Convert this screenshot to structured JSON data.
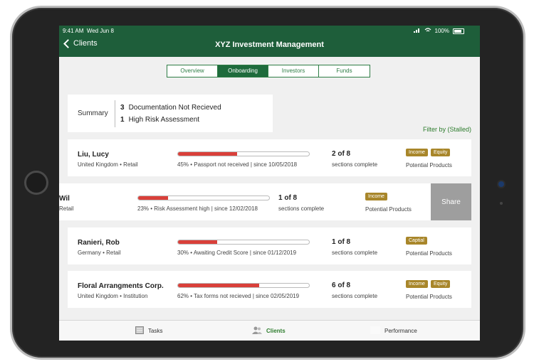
{
  "status": {
    "time": "9:41 AM",
    "date": "Wed Jun 8",
    "battery": "100%"
  },
  "header": {
    "back_label": "Clients",
    "title": "XYZ Investment Management"
  },
  "tabs": [
    {
      "label": "Overview",
      "active": false
    },
    {
      "label": "Onboarding",
      "active": true
    },
    {
      "label": "Investors",
      "active": false
    },
    {
      "label": "Funds",
      "active": false
    }
  ],
  "summary": {
    "label": "Summary",
    "items": [
      {
        "count": "3",
        "text": "Documentation Not Recieved"
      },
      {
        "count": "1",
        "text": "High Risk Assessment"
      }
    ]
  },
  "filter_label": "Filter by (Stalled)",
  "clients": [
    {
      "name": "Liu, Lucy",
      "sub": "United Kingdom • Retail",
      "progress": 0.45,
      "note": "45% • Passport not received | since 10/05/2018",
      "count": "2 of 8",
      "sections": "sections complete",
      "tags": [
        "Income",
        "Equity"
      ],
      "products": "Potential Products"
    },
    {
      "name": "Wil",
      "sub": "Retail",
      "progress": 0.23,
      "note": "23% • Risk Assessment high | since 12/02/2018",
      "count": "1 of 8",
      "sections": "sections complete",
      "tags": [
        "Income"
      ],
      "products": "Potential Products"
    },
    {
      "name": "Ranieri, Rob",
      "sub": "Germany • Retail",
      "progress": 0.3,
      "note": "30% • Awaiting Credit Score | since 01/12/2019",
      "count": "1 of 8",
      "sections": "sections complete",
      "tags": [
        "Captial"
      ],
      "products": "Potential Products"
    },
    {
      "name": "Floral Arrangments Corp.",
      "sub": "United Kingdom • Institution",
      "progress": 0.62,
      "note": "62% • Tax forms not recieved | since 02/05/2019",
      "count": "6 of 8",
      "sections": "sections complete",
      "tags": [
        "Income",
        "Equity"
      ],
      "products": "Potential Products"
    }
  ],
  "share_label": "Share",
  "bottom_nav": [
    {
      "label": "Tasks",
      "icon": "tasks-icon",
      "active": false
    },
    {
      "label": "Clients",
      "icon": "clients-icon",
      "active": true
    },
    {
      "label": "Performance",
      "icon": "performance-icon",
      "active": false
    }
  ],
  "colors": {
    "brand": "#1e5e3a",
    "progress": "#d9403a",
    "tag": "#a8862a",
    "accent": "#2e7d2e"
  }
}
